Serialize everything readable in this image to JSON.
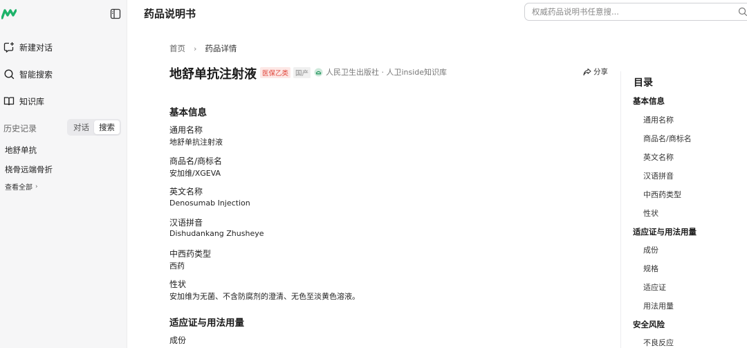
{
  "sidebar": {
    "nav": [
      {
        "label": "新建对话",
        "icon": "new-chat-icon"
      },
      {
        "label": "智能搜索",
        "icon": "search-icon"
      },
      {
        "label": "知识库",
        "icon": "book-icon"
      }
    ],
    "history_title": "历史记录",
    "history_tabs": [
      "对话",
      "搜索"
    ],
    "history_active_tab": "搜索",
    "history_items": [
      "地舒单抗",
      "桡骨远端骨折"
    ],
    "view_all": "查看全部"
  },
  "header": {
    "title": "药品说明书",
    "search_placeholder": "权威药品说明书任意搜..."
  },
  "breadcrumb": {
    "home": "首页",
    "current": "药品详情"
  },
  "drug": {
    "name": "地舒单抗注射液",
    "insurance_badge": "医保乙类",
    "origin_badge": "国产",
    "publisher": "人民卫生出版社 · 人卫inside知识库",
    "share": "分享"
  },
  "sections": {
    "basic_info": "基本信息",
    "indication": "适应证与用法用量"
  },
  "fields": [
    {
      "label": "通用名称",
      "value": "地舒单抗注射液"
    },
    {
      "label": "商品名/商标名",
      "value": "安加维/XGEVA"
    },
    {
      "label": "英文名称",
      "value": "Denosumab Injection"
    },
    {
      "label": "汉语拼音",
      "value": "Dishudankang Zhusheye"
    },
    {
      "label": "中西药类型",
      "value": "西药"
    },
    {
      "label": "性状",
      "value": "安加维为无菌、不含防腐剂的澄清、无色至淡黄色溶液。"
    }
  ],
  "composition_label": "成份",
  "toc": {
    "title": "目录",
    "groups": [
      {
        "label": "基本信息",
        "items": [
          "通用名称",
          "商品名/商标名",
          "英文名称",
          "汉语拼音",
          "中西药类型",
          "性状"
        ]
      },
      {
        "label": "适应证与用法用量",
        "items": [
          "成份",
          "规格",
          "适应证",
          "用法用量"
        ]
      },
      {
        "label": "安全风险",
        "items": [
          "不良反应"
        ]
      }
    ]
  },
  "colors": {
    "accent_green": "#1db36a",
    "badge_red": "#e0453a",
    "sidebar_bg": "#f6f6f7"
  }
}
